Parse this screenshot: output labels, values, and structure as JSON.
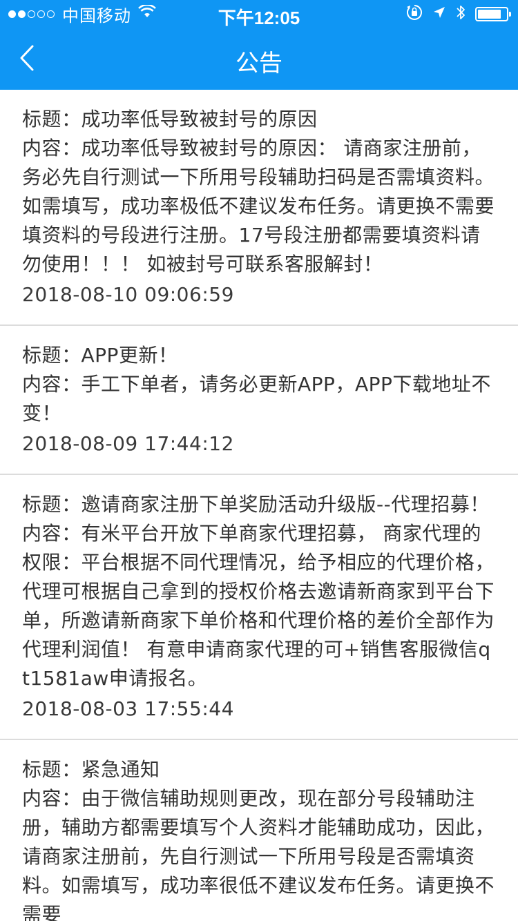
{
  "status_bar": {
    "carrier": "中国移动",
    "time": "下午12:05"
  },
  "nav": {
    "title": "公告"
  },
  "labels": {
    "title_prefix": "标题：",
    "content_prefix": "内容："
  },
  "announcements": [
    {
      "title": "成功率低导致被封号的原因",
      "content": "成功率低导致被封号的原因： 请商家注册前，务必先自行测试一下所用号段辅助扫码是否需填资料。如需填写，成功率极低不建议发布任务。请更换不需要填资料的号段进行注册。17号段注册都需要填资料请勿使用！！！ 如被封号可联系客服解封！",
      "date": "2018-08-10 09:06:59"
    },
    {
      "title": "APP更新！",
      "content": "手工下单者，请务必更新APP，APP下载地址不变！",
      "date": "2018-08-09 17:44:12"
    },
    {
      "title": "邀请商家注册下单奖励活动升级版--代理招募！",
      "content": "有米平台开放下单商家代理招募， 商家代理的权限：平台根据不同代理情况，给予相应的代理价格，代理可根据自己拿到的授权价格去邀请新商家到平台下单，所邀请新商家下单价格和代理价格的差价全部作为代理利润值！ 有意申请商家代理的可+销售客服微信qt1581aw申请报名。",
      "date": "2018-08-03 17:55:44"
    },
    {
      "title": "紧急通知",
      "content": "由于微信辅助规则更改，现在部分号段辅助注册，辅助方都需要填写个人资料才能辅助成功，因此，请商家注册前，先自行测试一下所用号段是否需填资料。如需填写，成功率很低不建议发布任务。请更换不需要",
      "date": ""
    }
  ]
}
